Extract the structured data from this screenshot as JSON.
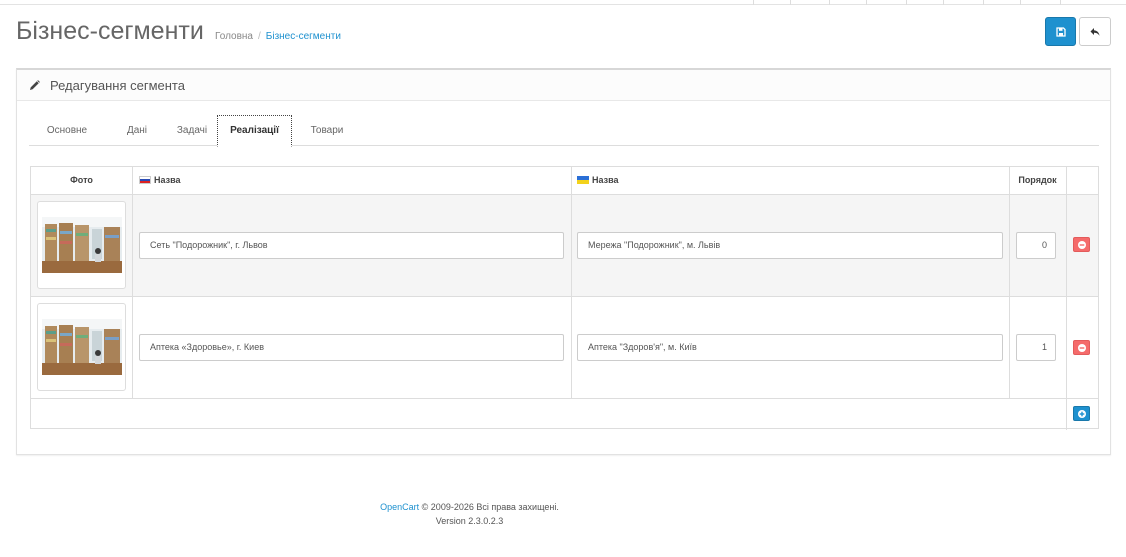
{
  "header": {
    "title": "Бізнес-сегменти",
    "breadcrumb": {
      "home": "Головна",
      "separator": "/",
      "current": "Бізнес-сегменти"
    }
  },
  "toolbar": {
    "save_icon": "save-icon",
    "back_icon": "reply-icon"
  },
  "panel": {
    "icon": "pencil-icon",
    "title": "Редагування сегмента",
    "tabs": [
      "Основне",
      "Дані",
      "Задачі",
      "Реалізації",
      "Товари"
    ],
    "active_tab": "Реалізації"
  },
  "table": {
    "columns": {
      "photo": "Фото",
      "name_ru": "Назва",
      "name_ua": "Назва",
      "order": "Порядок"
    },
    "rows": [
      {
        "name_ru": "Сеть \"Подорожник\", г. Львов",
        "name_ua": "Мережа \"Подорожник\", м. Львів",
        "order": "0"
      },
      {
        "name_ru": "Аптека «Здоровье», г. Киев",
        "name_ua": "Аптека \"Здоров'я\", м. Київ",
        "order": "1"
      }
    ]
  },
  "footer": {
    "brand": "OpenCart",
    "copyright": "© 2009-2026 Всі права захищені.",
    "version": "Version 2.3.0.2.3"
  },
  "colors": {
    "primary": "#1e91cf",
    "danger": "#f56b6b",
    "border": "#dddddd"
  }
}
